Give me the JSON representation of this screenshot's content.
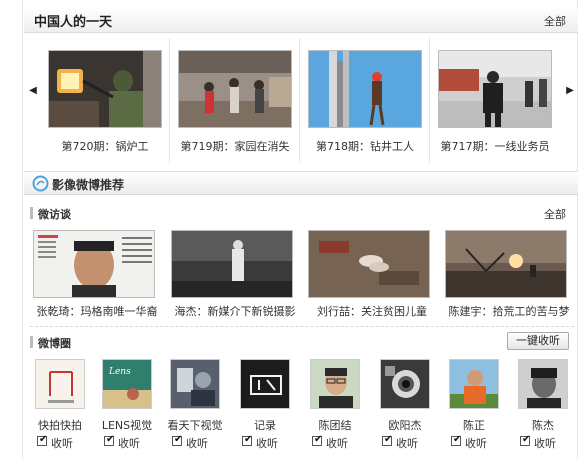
{
  "section1": {
    "title": "中国人的一天",
    "more": "全部",
    "arrow_left": "◀",
    "arrow_right": "▶",
    "items": [
      {
        "caption": "第720期：锅炉工"
      },
      {
        "caption": "第719期：家园在消失"
      },
      {
        "caption": "第718期：钻井工人"
      },
      {
        "caption": "第717期：一线业务员"
      }
    ]
  },
  "section2": {
    "title": "影像微博推荐",
    "icon": "weibo-icon"
  },
  "interviews": {
    "title": "微访谈",
    "more": "全部",
    "items": [
      {
        "caption": "张乾琦：玛格南唯一华裔"
      },
      {
        "caption": "海杰：新媒介下新锐摄影"
      },
      {
        "caption": "刘行喆：关注贫困儿童"
      },
      {
        "caption": "陈建宇：拾荒工的苦与梦"
      }
    ]
  },
  "weibo_circle": {
    "title": "微博圈",
    "listen_all": "一键收听",
    "follow_label": "收听",
    "check_mark": "✔",
    "accounts": [
      {
        "name": "快拍快拍"
      },
      {
        "name": "LENS视觉"
      },
      {
        "name": "看天下视觉"
      },
      {
        "name": "记录"
      },
      {
        "name": "陈团结"
      },
      {
        "name": "欧阳杰"
      },
      {
        "name": "陈正"
      },
      {
        "name": "陈杰"
      }
    ]
  },
  "colors": {
    "weibo_icon": "#4ba3d9",
    "header_gradient_end": "#eeeeee",
    "border": "#dcdcdc"
  }
}
